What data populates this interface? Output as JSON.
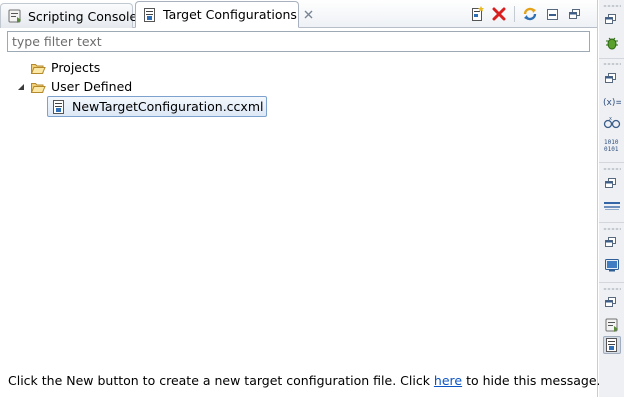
{
  "tabs": [
    {
      "label": "Scripting Console",
      "icon": "scripting-console-icon",
      "active": false
    },
    {
      "label": "Target Configurations",
      "icon": "target-config-icon",
      "active": true,
      "closable": true
    }
  ],
  "toolbar": {
    "icons": [
      "new-target-config-icon",
      "delete-icon",
      "link-sync-icon",
      "minimize-icon",
      "maximize-icon"
    ]
  },
  "filter": {
    "placeholder": "type filter text",
    "value": ""
  },
  "tree": {
    "projects": {
      "label": "Projects",
      "icon": "folder-open-icon",
      "expanded": false
    },
    "user_defined": {
      "label": "User Defined",
      "icon": "folder-open-icon",
      "expanded": true,
      "children": [
        {
          "label": "NewTargetConfiguration.ccxml",
          "icon": "ccxml-file-icon",
          "selected": true
        }
      ]
    }
  },
  "message": {
    "before": "Click the New button to create a new target configuration file. Click ",
    "link": "here",
    "after": " to hide this message."
  },
  "colors": {
    "link": "#0b55c4",
    "selection_border": "#7da2ce",
    "delete_red": "#d81e1e"
  }
}
